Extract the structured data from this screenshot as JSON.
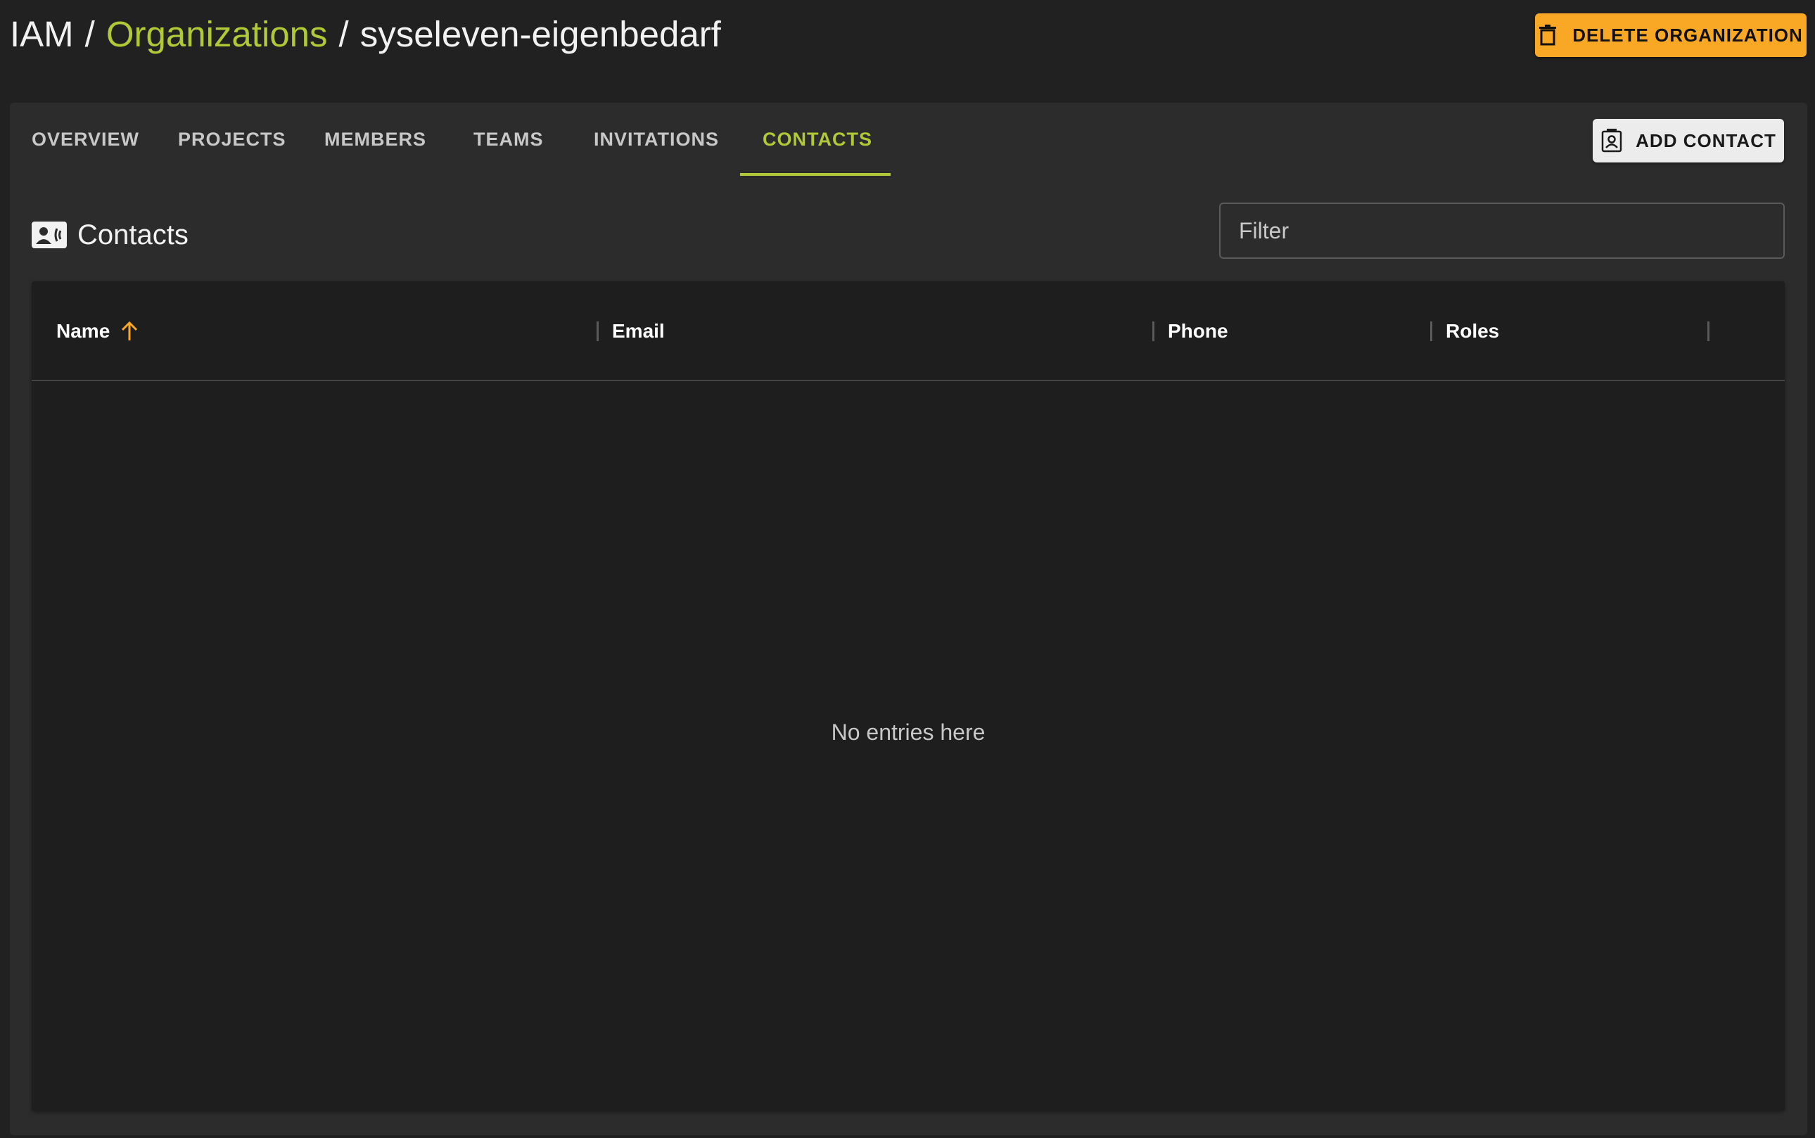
{
  "breadcrumb": {
    "root": "IAM",
    "separator": "/",
    "organizations": "Organizations",
    "current": "syseleven-eigenbedarf"
  },
  "header": {
    "delete_label": "DELETE ORGANIZATION",
    "delete_icon": "trash-icon"
  },
  "tabs": [
    {
      "label": "OVERVIEW",
      "active": false
    },
    {
      "label": "PROJECTS",
      "active": false
    },
    {
      "label": "MEMBERS",
      "active": false
    },
    {
      "label": "TEAMS",
      "active": false
    },
    {
      "label": "INVITATIONS",
      "active": false
    },
    {
      "label": "CONTACTS",
      "active": true
    }
  ],
  "toolbar": {
    "add_contact_label": "ADD CONTACT",
    "add_contact_icon": "contact-card-icon"
  },
  "section": {
    "title": "Contacts",
    "icon": "contacts-icon"
  },
  "filter": {
    "placeholder": "Filter",
    "value": ""
  },
  "table": {
    "columns": [
      {
        "label": "Name",
        "sorted": "ascending"
      },
      {
        "label": "Email"
      },
      {
        "label": "Phone"
      },
      {
        "label": "Roles"
      }
    ],
    "rows": [],
    "empty_text": "No entries here"
  },
  "colors": {
    "background": "#212121",
    "card": "#2c2c2c",
    "table": "#1e1e1e",
    "accent_green": "#b0c936",
    "accent_orange": "#f9a825",
    "text": "#ffffff",
    "muted_text": "#c8c8c8"
  }
}
